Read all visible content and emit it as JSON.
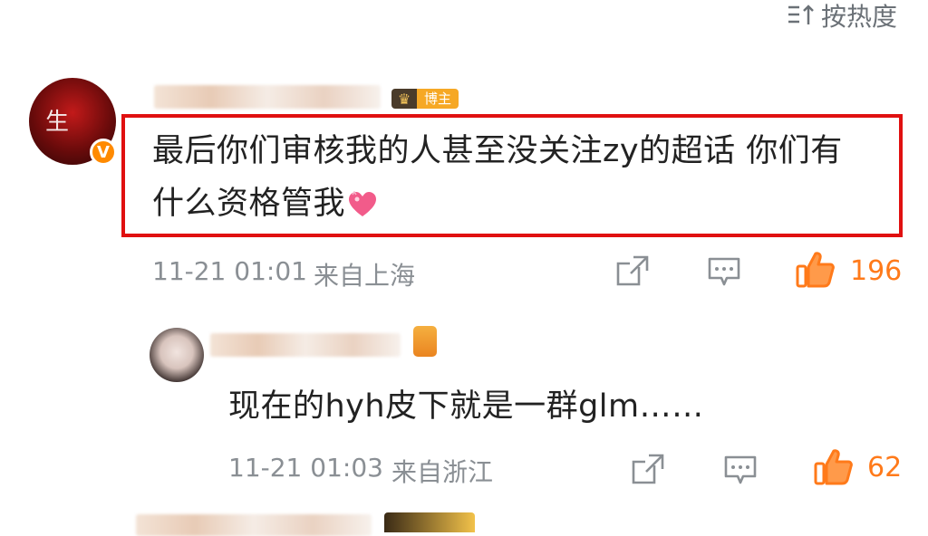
{
  "sort": {
    "label": "按热度",
    "icon": "sort-icon"
  },
  "comments": [
    {
      "avatar_text": "生",
      "verified_icon": "verified-badge-icon",
      "username_blurred": true,
      "badge_label": "博主",
      "text_line1": "最后你们审核我的人甚至没关注zy的超话 你们有",
      "text_line2": "什么资格管我",
      "emoji": "heart-emoji-icon",
      "time": "11-21 01:01",
      "source": "来自上海",
      "likes": "196"
    },
    {
      "username_blurred": true,
      "text": "现在的hyh皮下就是一群glm……",
      "time": "11-21 01:03",
      "source": "来自浙江",
      "likes": "62"
    }
  ],
  "colors": {
    "highlight_box": "#e01010",
    "like_accent": "#ff7a1a",
    "meta_text": "#8a8f94"
  }
}
